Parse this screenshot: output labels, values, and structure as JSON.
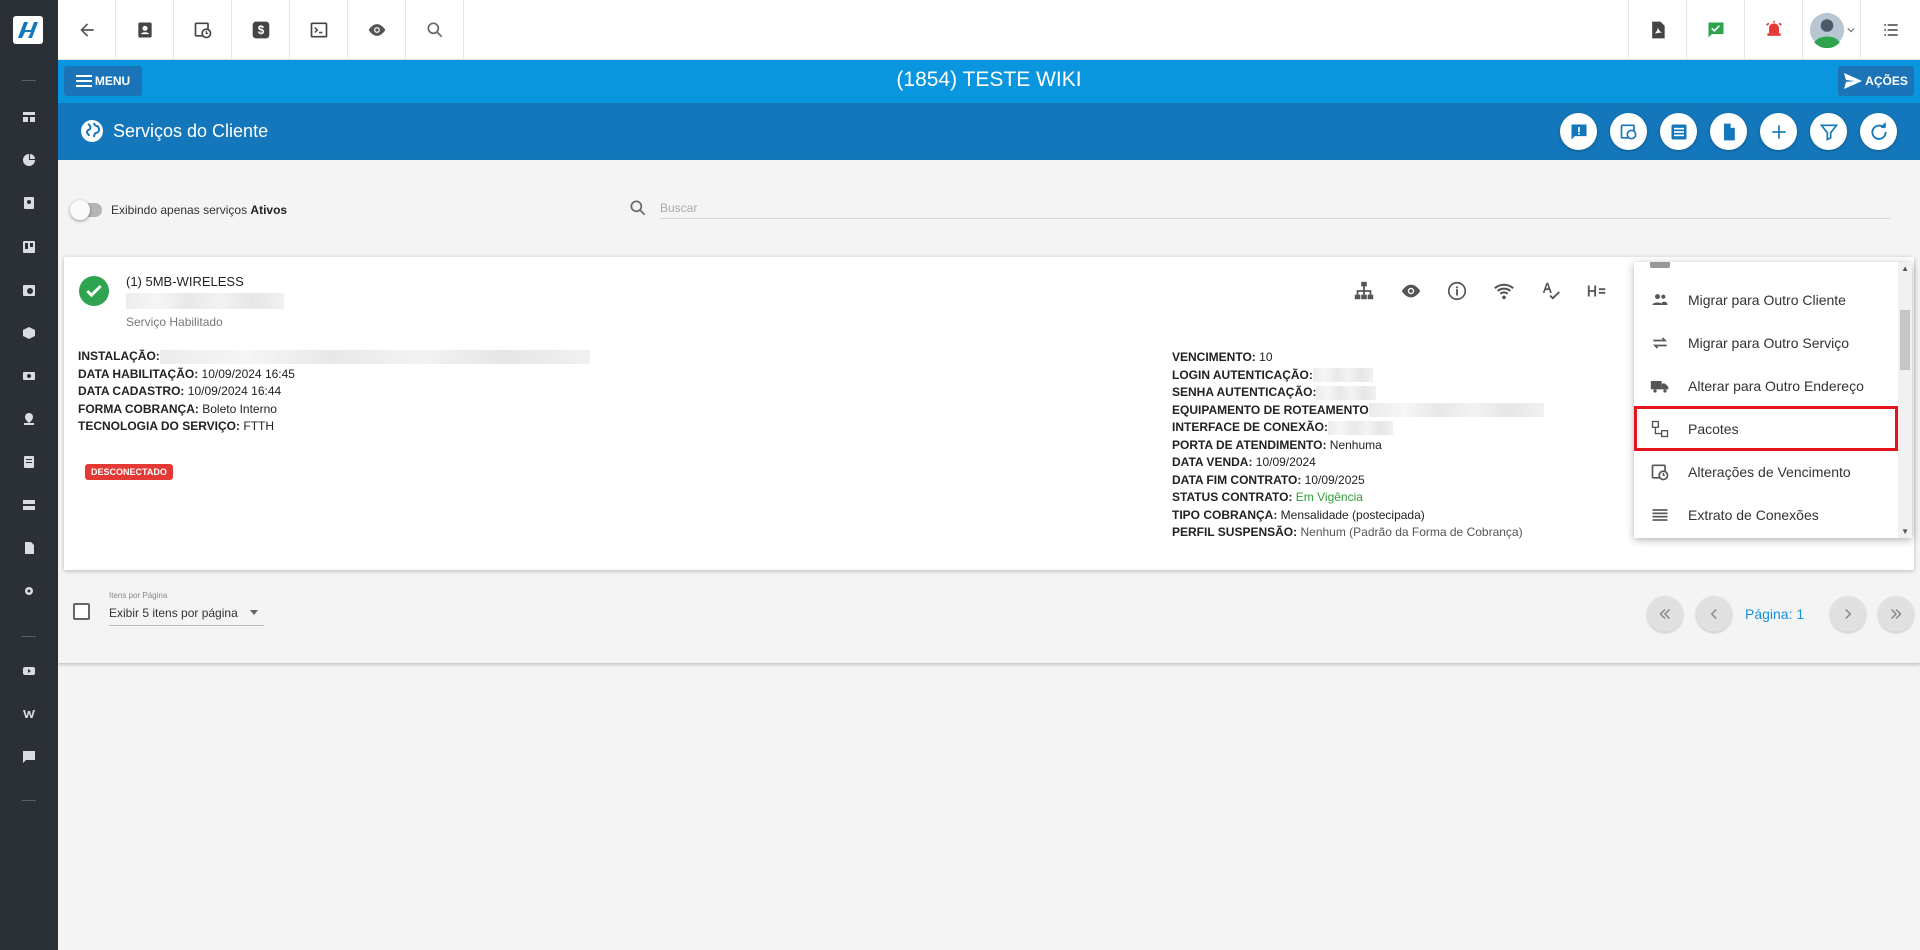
{
  "app": {
    "client_title": "(1854) TESTE WIKI",
    "menu_label": "MENU",
    "actions_label": "AÇÕES"
  },
  "section": {
    "title": "Serviços do Cliente"
  },
  "filter": {
    "toggle_label": "Exibindo apenas serviços",
    "toggle_bold": "Ativos",
    "search_placeholder": "Buscar"
  },
  "service": {
    "name": "(1) 5MB-WIRELESS",
    "status": "Serviço Habilitado",
    "badge": "DESCONECTADO",
    "left_fields": [
      {
        "label": "INSTALAÇÃO:",
        "value": ""
      },
      {
        "label": "DATA HABILITAÇÃO:",
        "value": "10/09/2024 16:45"
      },
      {
        "label": "DATA CADASTRO:",
        "value": "10/09/2024 16:44"
      },
      {
        "label": "FORMA COBRANÇA:",
        "value": "Boleto Interno"
      },
      {
        "label": "TECNOLOGIA DO SERVIÇO:",
        "value": "FTTH"
      }
    ],
    "right_fields": [
      {
        "label": "VENCIMENTO:",
        "value": "10"
      },
      {
        "label": "LOGIN AUTENTICAÇÃO:",
        "value": ""
      },
      {
        "label": "SENHA AUTENTICAÇÃO:",
        "value": ""
      },
      {
        "label": "EQUIPAMENTO DE ROTEAMENTO",
        "value": ""
      },
      {
        "label": "INTERFACE DE CONEXÃO:",
        "value": ""
      },
      {
        "label": "PORTA DE ATENDIMENTO:",
        "value": "Nenhuma"
      },
      {
        "label": "DATA VENDA:",
        "value": "10/09/2024"
      },
      {
        "label": "DATA FIM CONTRATO:",
        "value": "10/09/2025"
      },
      {
        "label": "STATUS CONTRATO:",
        "value": "Em Vigência"
      },
      {
        "label": "TIPO COBRANÇA:",
        "value": "Mensalidade (postecipada)"
      },
      {
        "label": "PERFIL SUSPENSÃO:",
        "value": "Nenhum (Padrão da Forma de Cobrança)"
      }
    ]
  },
  "dropdown": {
    "items": [
      {
        "label": "Migrar para Outro Cliente",
        "icon": "people-icon"
      },
      {
        "label": "Migrar para Outro Serviço",
        "icon": "swap-icon"
      },
      {
        "label": "Alterar para Outro Endereço",
        "icon": "truck-icon"
      },
      {
        "label": "Pacotes",
        "icon": "package-icon"
      },
      {
        "label": "Alterações de Vencimento",
        "icon": "calendar-clock-icon"
      },
      {
        "label": "Extrato de Conexões",
        "icon": "list-icon"
      }
    ]
  },
  "pagination": {
    "perpage_label": "Itens por Página",
    "perpage_value": "Exibir 5 itens por página",
    "page_label": "Página: 1"
  },
  "colors": {
    "title_bar": "#0a96de",
    "section_bar": "#1477bb",
    "success": "#2ea44f",
    "danger": "#e53935",
    "highlight": "#e5131e"
  }
}
